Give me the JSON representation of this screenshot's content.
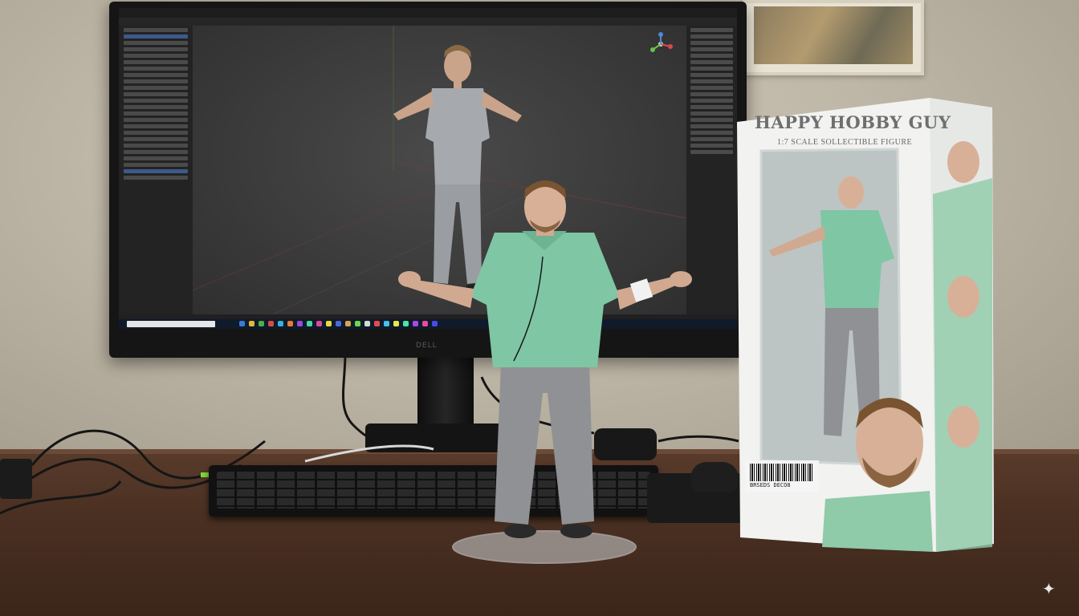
{
  "scene": {
    "description_free": true
  },
  "monitor": {
    "brand_text": "DELL"
  },
  "package": {
    "title": "HAPPY HOBBY GUY",
    "subtitle": "1:7 SCALE SOLLECTIBLE FIGURE",
    "barcode_number": "BRSEDS DECO8"
  },
  "colors": {
    "shirt": "#7fc6a4",
    "pants": "#8f8f8f",
    "desk": "#4a3022",
    "wall": "#c6bfb0"
  }
}
